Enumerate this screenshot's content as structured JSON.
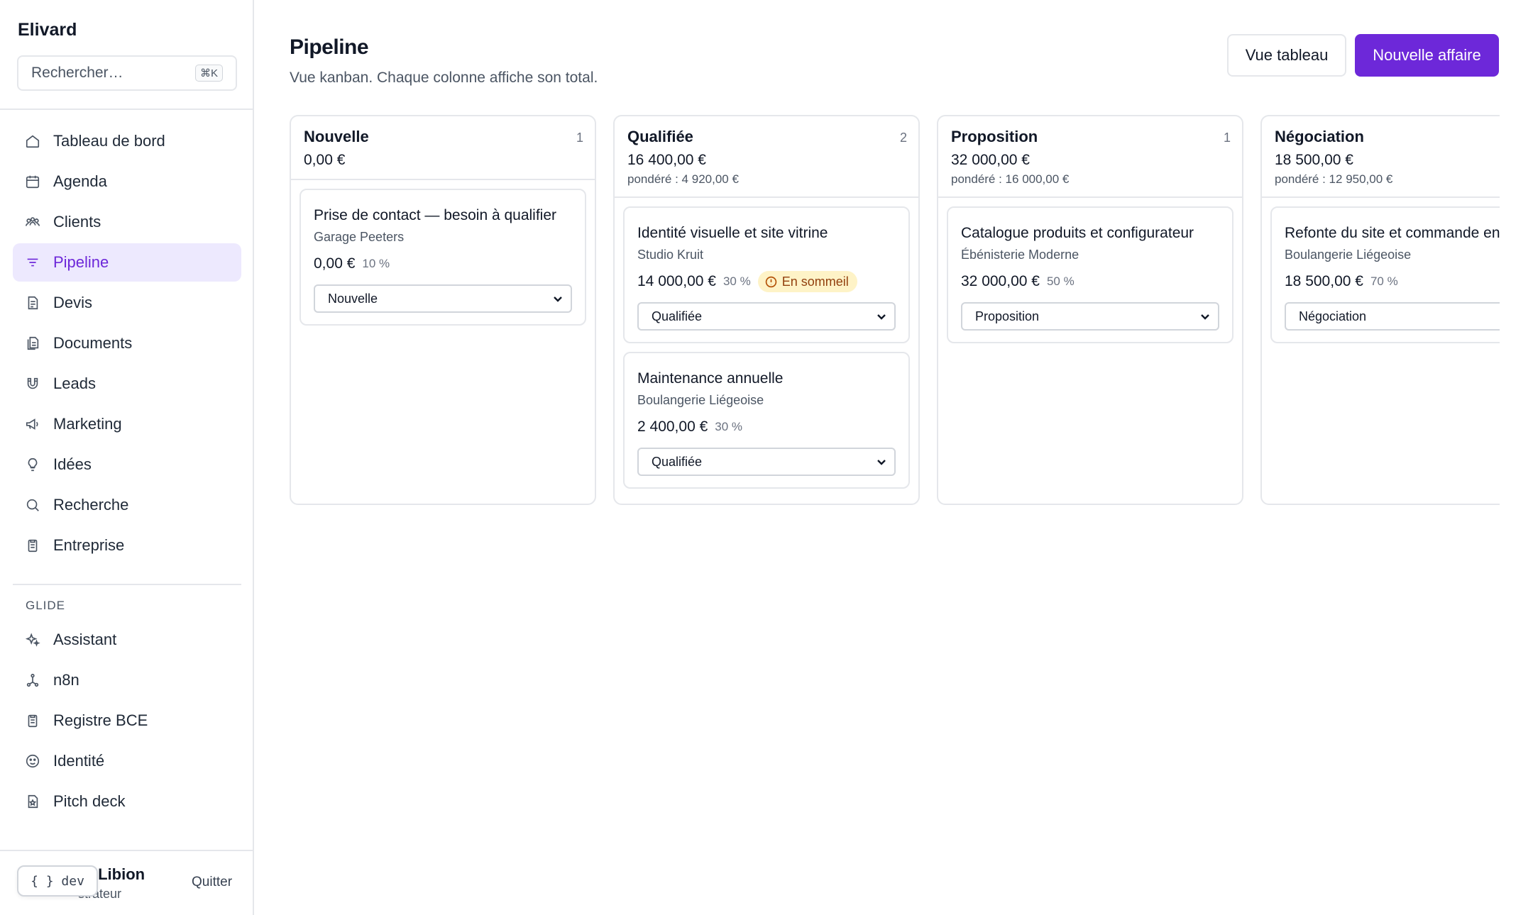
{
  "app": {
    "name": "Elivard"
  },
  "search": {
    "placeholder": "Rechercher…",
    "shortcut": "⌘K"
  },
  "sidebar": {
    "items": [
      {
        "label": "Tableau de bord",
        "icon": "home-icon"
      },
      {
        "label": "Agenda",
        "icon": "calendar-icon"
      },
      {
        "label": "Clients",
        "icon": "users-icon"
      },
      {
        "label": "Pipeline",
        "icon": "filter-icon",
        "active": true
      },
      {
        "label": "Devis",
        "icon": "file-text-icon"
      },
      {
        "label": "Documents",
        "icon": "files-icon"
      },
      {
        "label": "Leads",
        "icon": "magnet-icon"
      },
      {
        "label": "Marketing",
        "icon": "megaphone-icon"
      },
      {
        "label": "Idées",
        "icon": "lightbulb-icon"
      },
      {
        "label": "Recherche",
        "icon": "search-icon"
      },
      {
        "label": "Entreprise",
        "icon": "clipboard-icon"
      }
    ],
    "section_label": "GLIDE",
    "glide_items": [
      {
        "label": "Assistant",
        "icon": "sparkles-icon"
      },
      {
        "label": "n8n",
        "icon": "workflow-icon"
      },
      {
        "label": "Registre BCE",
        "icon": "clipboard-icon"
      },
      {
        "label": "Identité",
        "icon": "smiley-icon"
      },
      {
        "label": "Pitch deck",
        "icon": "file-star-icon"
      }
    ],
    "user": {
      "name_visible": "rd Libion",
      "role_visible": "strateur",
      "quit_label": "Quitter"
    },
    "dev_label": "{ } dev"
  },
  "header": {
    "title": "Pipeline",
    "subtitle": "Vue kanban. Chaque colonne affiche son total.",
    "table_view_label": "Vue tableau",
    "new_deal_label": "Nouvelle affaire"
  },
  "colors": {
    "accent": "#6d28d9",
    "accent_soft": "#ede9fe",
    "badge_bg": "#fef3c7",
    "badge_fg": "#92400e"
  },
  "columns": [
    {
      "title": "Nouvelle",
      "count": "1",
      "total": "0,00 €",
      "weighted": "",
      "cards": [
        {
          "title": "Prise de contact — besoin à qualifier",
          "client": "Garage Peeters",
          "amount": "0,00 €",
          "prob": "10 %",
          "badge": "",
          "stage": "Nouvelle"
        }
      ]
    },
    {
      "title": "Qualifiée",
      "count": "2",
      "total": "16 400,00 €",
      "weighted": "pondéré : 4 920,00 €",
      "cards": [
        {
          "title": "Identité visuelle et site vitrine",
          "client": "Studio Kruit",
          "amount": "14 000,00 €",
          "prob": "30 %",
          "badge": "En sommeil",
          "stage": "Qualifiée"
        },
        {
          "title": "Maintenance annuelle",
          "client": "Boulangerie Liégeoise",
          "amount": "2 400,00 €",
          "prob": "30 %",
          "badge": "",
          "stage": "Qualifiée"
        }
      ]
    },
    {
      "title": "Proposition",
      "count": "1",
      "total": "32 000,00 €",
      "weighted": "pondéré : 16 000,00 €",
      "cards": [
        {
          "title": "Catalogue produits et configurateur",
          "client": "Ébénisterie Moderne",
          "amount": "32 000,00 €",
          "prob": "50 %",
          "badge": "",
          "stage": "Proposition"
        }
      ]
    },
    {
      "title": "Négociation",
      "count": "",
      "total": "18 500,00 €",
      "weighted": "pondéré : 12 950,00 €",
      "cards": [
        {
          "title": "Refonte du site et commande en ligne",
          "client": "Boulangerie Liégeoise",
          "amount": "18 500,00 €",
          "prob": "70 %",
          "badge": "",
          "stage": "Négociation"
        }
      ]
    }
  ]
}
